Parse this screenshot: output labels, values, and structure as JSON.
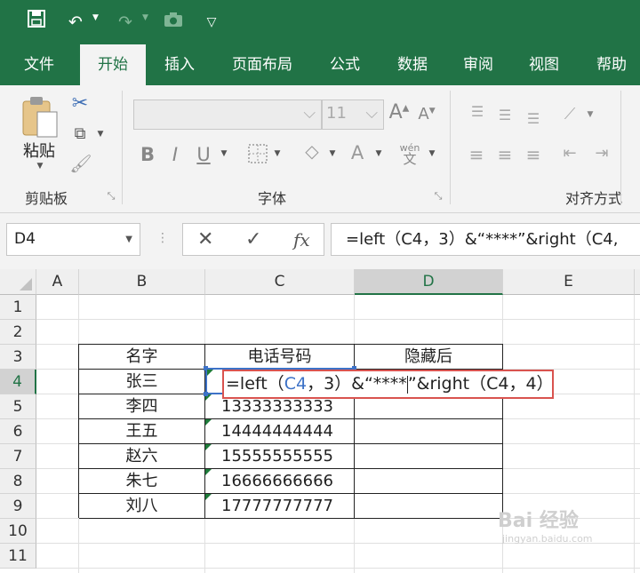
{
  "tabs": [
    "文件",
    "开始",
    "插入",
    "页面布局",
    "公式",
    "数据",
    "审阅",
    "视图",
    "帮助"
  ],
  "ribbon": {
    "paste_label": "粘贴",
    "clipboard_group": "剪贴板",
    "font_group": "字体",
    "align_group": "对齐方式",
    "font_size": "11",
    "phonetic_label": "wén"
  },
  "formula_bar": {
    "name_box": "D4",
    "formula": "=left（C4，3）&“****”&right（C4,"
  },
  "columns": [
    "A",
    "B",
    "C",
    "D",
    "E"
  ],
  "rows": [
    "1",
    "2",
    "3",
    "4",
    "5",
    "6",
    "7",
    "8",
    "9",
    "10",
    "11"
  ],
  "table": {
    "headers": [
      "名字",
      "电话号码",
      "隐藏后"
    ],
    "names": [
      "张三",
      "李四",
      "王五",
      "赵六",
      "朱七",
      "刘八"
    ],
    "phones": [
      "",
      "13333333333",
      "14444444444",
      "15555555555",
      "16666666666",
      "17777777777"
    ]
  },
  "edit_cell": {
    "part1": "=left（",
    "ref1": "C4",
    "part2": "，3）&“****",
    "part3": "”&right（C4，4）"
  },
  "watermark": {
    "main": "Bai 经验",
    "sub": "jingyan.baidu.com"
  },
  "colors": {
    "accent": "#217346",
    "edit_border": "#d9534f",
    "ref_blue": "#3d72c7"
  },
  "icons": [
    "save-icon",
    "undo-icon",
    "redo-icon",
    "camera-icon",
    "customize-icon",
    "cut-icon",
    "copy-icon",
    "format-painter-icon",
    "bold-icon",
    "italic-icon",
    "underline-icon",
    "border-icon",
    "fill-color-icon",
    "font-color-icon",
    "grow-font-icon",
    "shrink-font-icon",
    "cancel-icon",
    "enter-icon",
    "fx-icon"
  ]
}
